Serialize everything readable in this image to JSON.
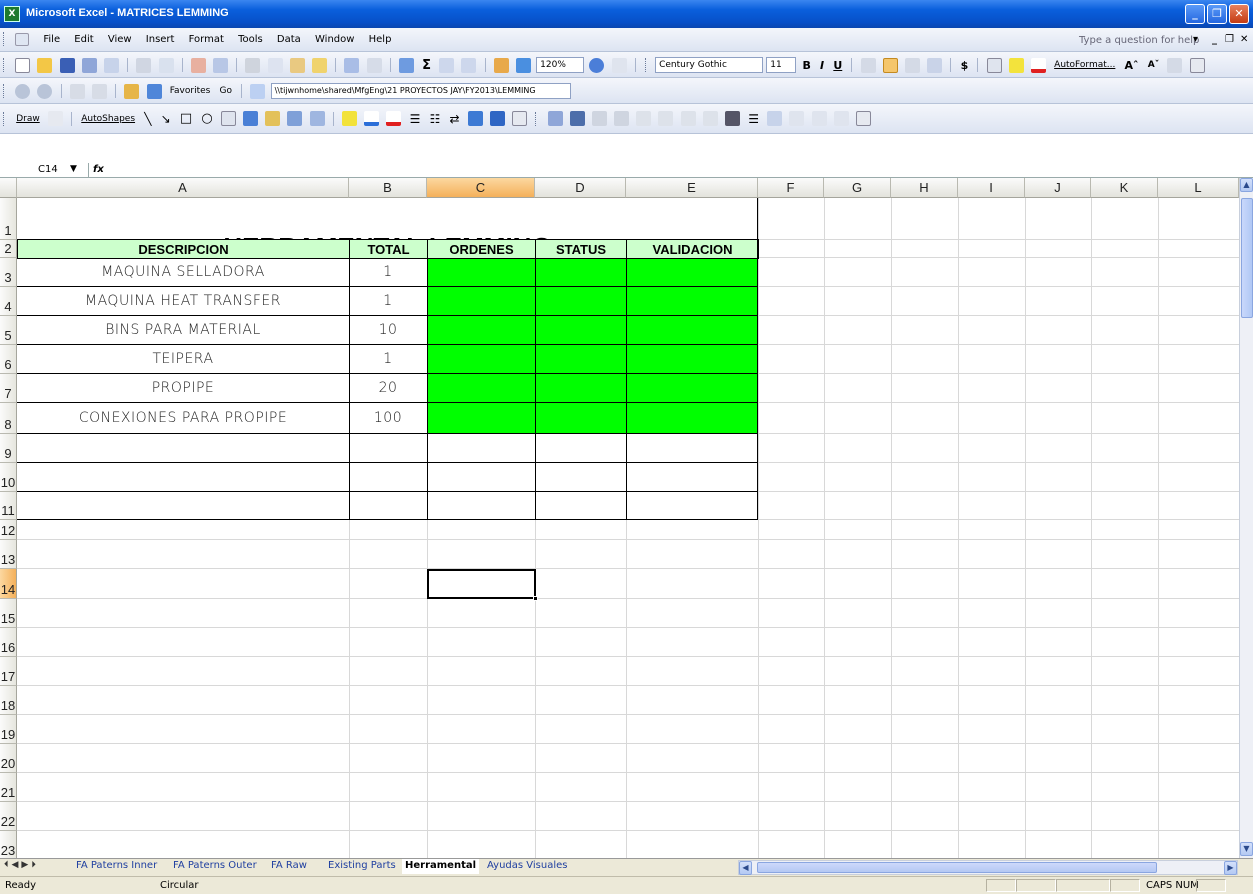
{
  "window": {
    "title": "Microsoft Excel - MATRICES LEMMING"
  },
  "menu": {
    "items": [
      "File",
      "Edit",
      "View",
      "Insert",
      "Format",
      "Tools",
      "Data",
      "Window",
      "Help"
    ],
    "help_placeholder": "Type a question for help"
  },
  "toolbar": {
    "zoom": "120%",
    "font": "Century Gothic",
    "font_size": "11",
    "bold": "B",
    "italic": "I",
    "underline": "U",
    "currency": "$",
    "autoformat": "AutoFormat...",
    "grow": "Aˆ",
    "shrink": "Aˇ"
  },
  "web": {
    "favorites": "Favorites",
    "go": "Go",
    "address": "\\\\tijwnhome\\shared\\MfgEng\\21 PROYECTOS JAY\\FY2013\\LEMMING"
  },
  "drawing": {
    "draw": "Draw",
    "autoshapes": "AutoShapes"
  },
  "formula_bar": {
    "name_box": "C14",
    "fx": "fx",
    "content": ""
  },
  "columns": [
    "A",
    "B",
    "C",
    "D",
    "E",
    "F",
    "G",
    "H",
    "I",
    "J",
    "K",
    "L"
  ],
  "rows": [
    "1",
    "2",
    "3",
    "4",
    "5",
    "6",
    "7",
    "8",
    "9",
    "10",
    "11",
    "12",
    "13",
    "14",
    "15",
    "16",
    "17",
    "18",
    "19",
    "20",
    "21",
    "22",
    "23"
  ],
  "sheet": {
    "title": "HERRAMENTAL LEMMING",
    "headers": [
      "DESCRIPCION",
      "TOTAL",
      "ORDENES",
      "STATUS",
      "VALIDACION"
    ],
    "items": [
      {
        "desc": "MAQUINA SELLADORA",
        "total": "1"
      },
      {
        "desc": "MAQUINA HEAT TRANSFER",
        "total": "1"
      },
      {
        "desc": "BINS PARA MATERIAL",
        "total": "10"
      },
      {
        "desc": "TEIPERA",
        "total": "1"
      },
      {
        "desc": "PROPIPE",
        "total": "20"
      },
      {
        "desc": "CONEXIONES PARA PROPIPE",
        "total": "100"
      }
    ],
    "header_fill": "#ccffcc",
    "status_fill": "#00ff00"
  },
  "tabs": [
    "FA Paterns Inner",
    "FA Paterns Outer",
    "FA Raw",
    "Existing Parts",
    "Herramental",
    "Ayudas Visuales"
  ],
  "active_tab": "Herramental",
  "status": {
    "left": "Ready",
    "mode": "Circular",
    "indicators": "CAPS NUM"
  }
}
